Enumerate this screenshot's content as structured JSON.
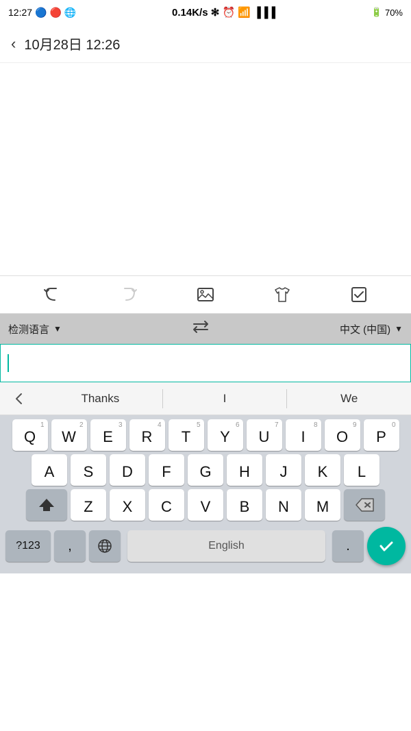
{
  "statusBar": {
    "time": "12:27",
    "network": "0.14K/s",
    "battery": "70%"
  },
  "header": {
    "title": "10月28日  12:26",
    "backLabel": "‹"
  },
  "toolbar": {
    "undoLabel": "undo",
    "redoLabel": "redo",
    "imageLabel": "image",
    "shirtLabel": "shirt",
    "checkLabel": "check"
  },
  "langBar": {
    "detectLang": "检测语言",
    "swapLabel": "⇄",
    "targetLang": "中文 (中国)"
  },
  "inputArea": {
    "placeholder": ""
  },
  "suggestions": {
    "items": [
      "Thanks",
      "I",
      "We"
    ]
  },
  "keyboard": {
    "row1": [
      {
        "letter": "Q",
        "num": "1"
      },
      {
        "letter": "W",
        "num": "2"
      },
      {
        "letter": "E",
        "num": "3"
      },
      {
        "letter": "R",
        "num": "4"
      },
      {
        "letter": "T",
        "num": "5"
      },
      {
        "letter": "Y",
        "num": "6"
      },
      {
        "letter": "U",
        "num": "7"
      },
      {
        "letter": "I",
        "num": "8"
      },
      {
        "letter": "O",
        "num": "9"
      },
      {
        "letter": "P",
        "num": "0"
      }
    ],
    "row2": [
      {
        "letter": "A"
      },
      {
        "letter": "S"
      },
      {
        "letter": "D"
      },
      {
        "letter": "F"
      },
      {
        "letter": "G"
      },
      {
        "letter": "H"
      },
      {
        "letter": "J"
      },
      {
        "letter": "K"
      },
      {
        "letter": "L"
      }
    ],
    "row3": [
      {
        "letter": "Z"
      },
      {
        "letter": "X"
      },
      {
        "letter": "C"
      },
      {
        "letter": "V"
      },
      {
        "letter": "B"
      },
      {
        "letter": "N"
      },
      {
        "letter": "M"
      }
    ],
    "spaceLabel": "English",
    "commaLabel": ",",
    "periodLabel": ".",
    "num123Label": "?123",
    "enterCheckmark": "✓"
  }
}
